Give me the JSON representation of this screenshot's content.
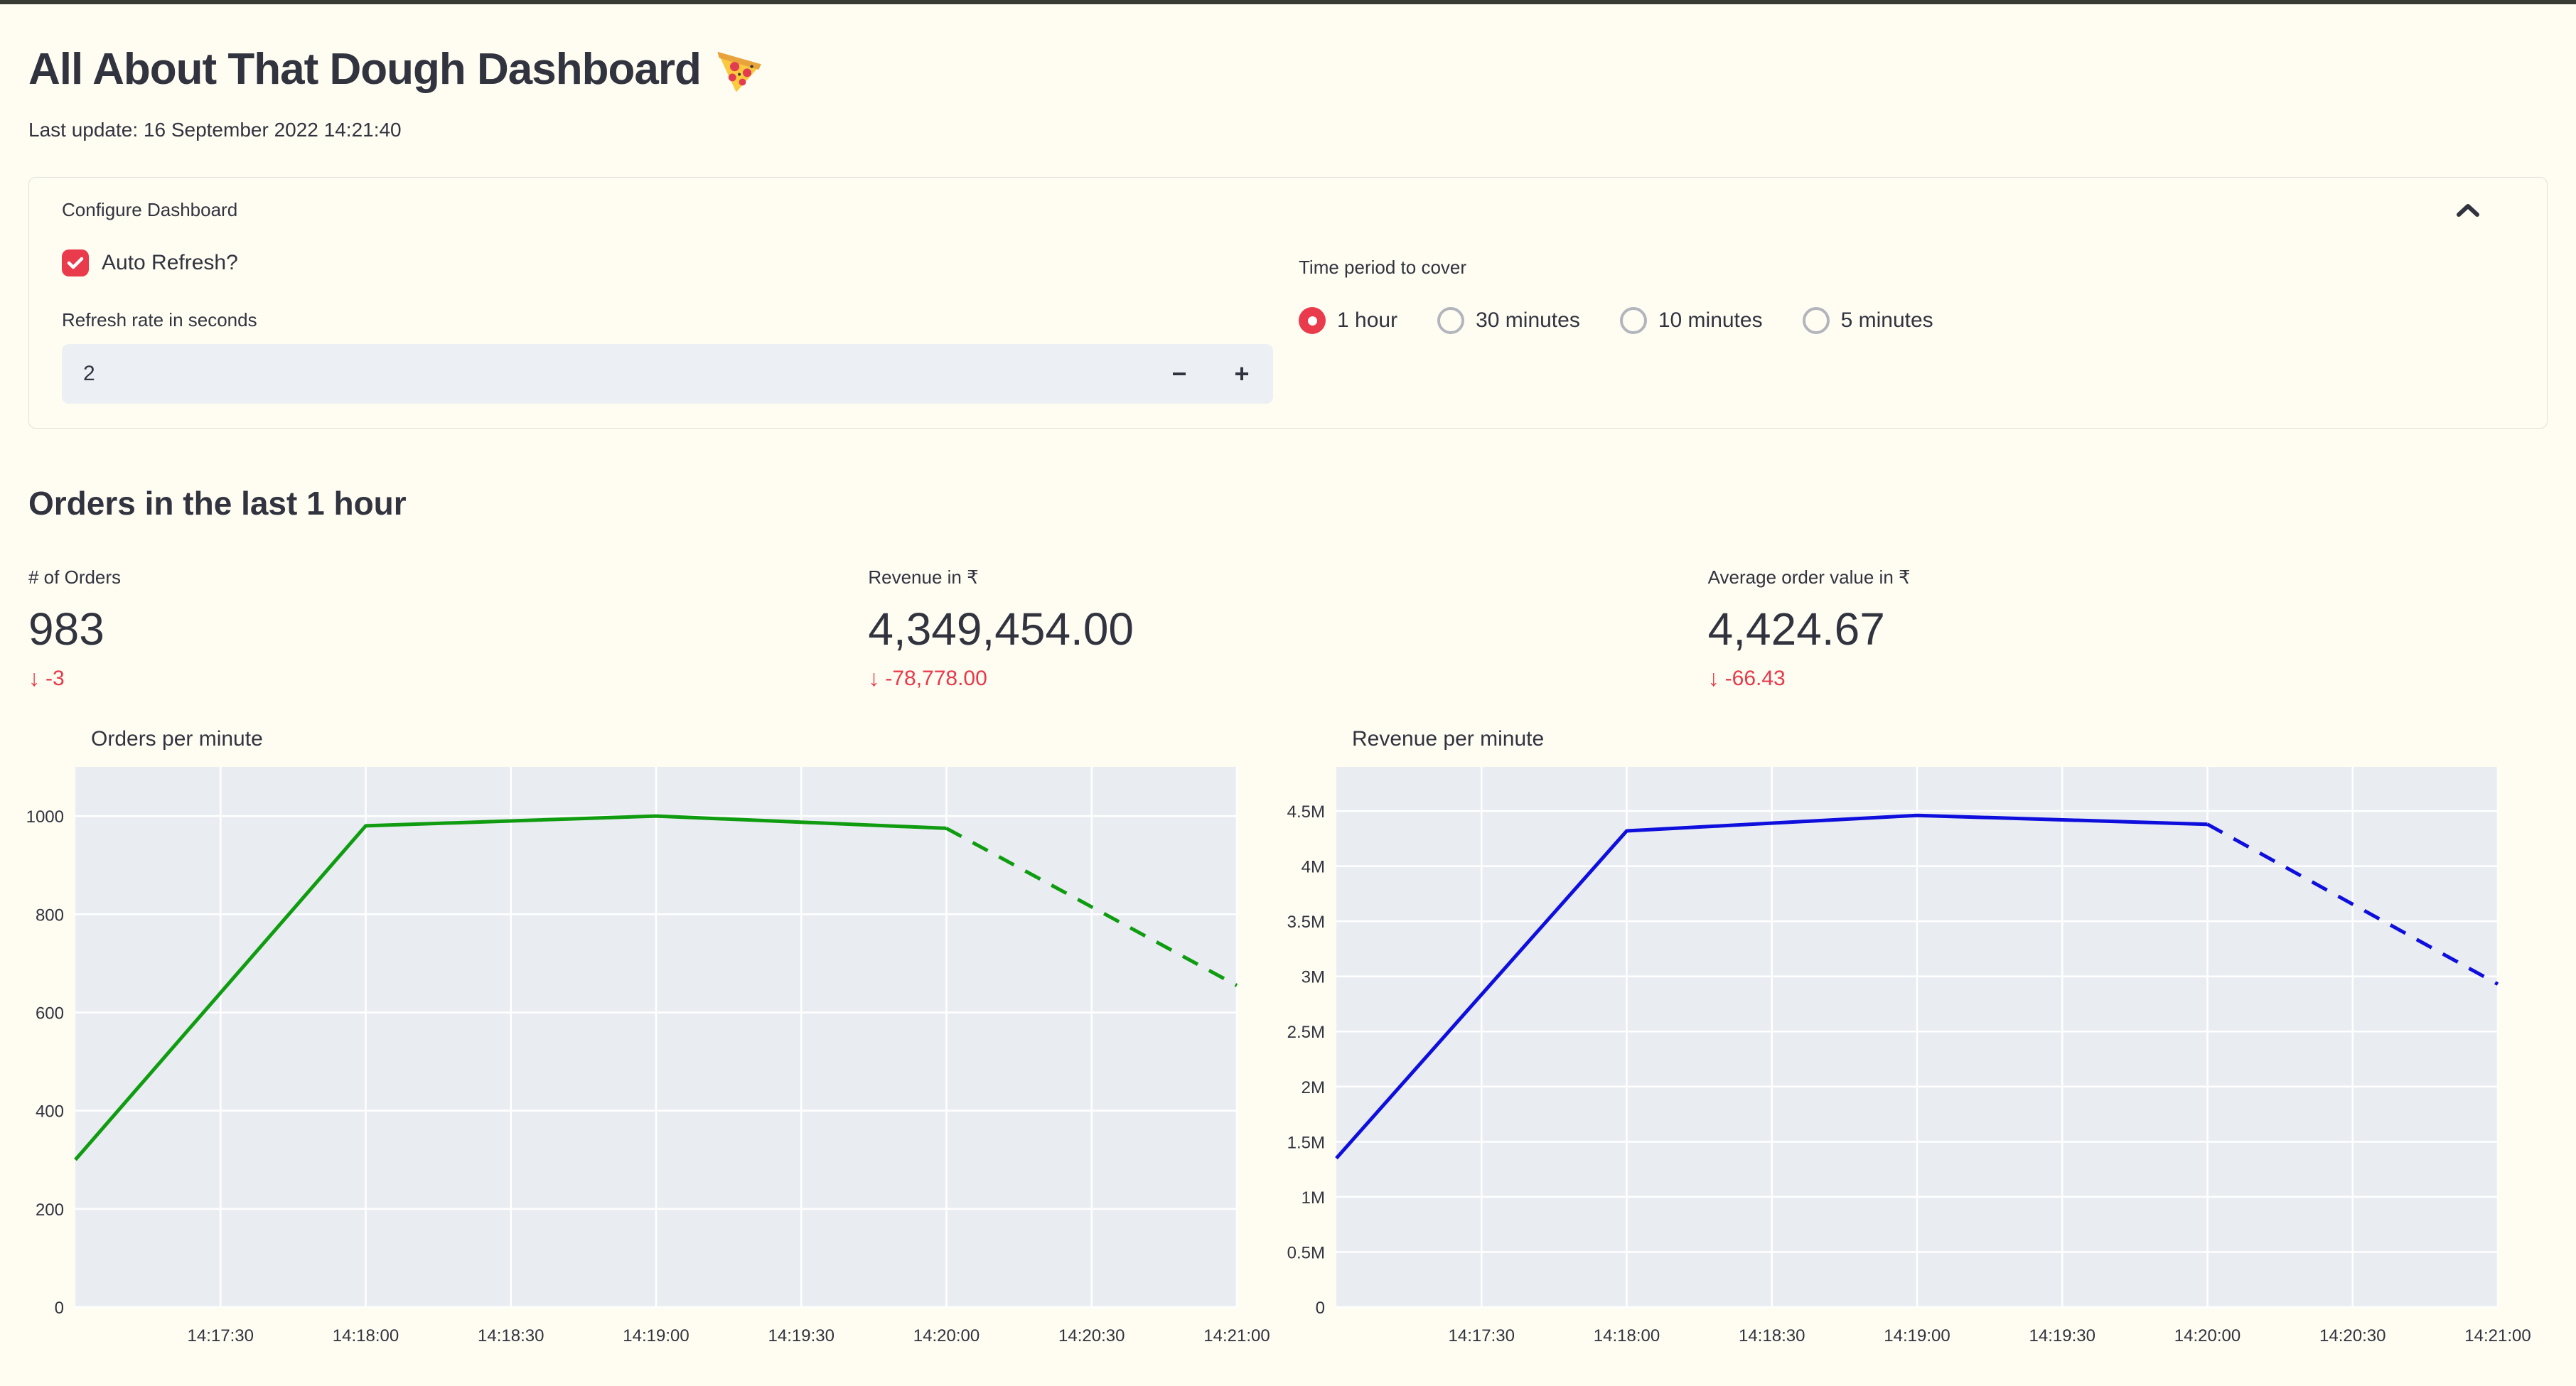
{
  "page": {
    "bg": "#fffdf2",
    "top_strip_color": "#3a3a34",
    "text_color": "#31333f",
    "accent_red": "#e93b4b",
    "delta_red": "#e8394a"
  },
  "header": {
    "title": "All About That Dough Dashboard",
    "title_icon": "pizza-slice",
    "last_update": "Last update: 16 September 2022 14:21:40"
  },
  "configure": {
    "title": "Configure Dashboard",
    "collapse_icon": "chevron-up",
    "auto_refresh_label": "Auto Refresh?",
    "auto_refresh_checked": true,
    "refresh_rate_label": "Refresh rate in seconds",
    "refresh_rate_value": "2",
    "minus_glyph": "−",
    "plus_glyph": "+",
    "time_period_label": "Time period to cover",
    "time_period_options": [
      {
        "label": "1 hour",
        "selected": true
      },
      {
        "label": "30 minutes",
        "selected": false
      },
      {
        "label": "10 minutes",
        "selected": false
      },
      {
        "label": "5 minutes",
        "selected": false
      }
    ]
  },
  "section": {
    "heading": "Orders in the last 1 hour"
  },
  "icons": {
    "arrow_down": "↓"
  },
  "metrics": [
    {
      "label": "# of Orders",
      "value": "983",
      "delta": "-3",
      "direction": "down"
    },
    {
      "label": "Revenue in ₹",
      "value": "4,349,454.00",
      "delta": "-78,778.00",
      "direction": "down"
    },
    {
      "label": "Average order value in ₹",
      "value": "4,424.67",
      "delta": "-66.43",
      "direction": "down"
    }
  ],
  "chart_data": [
    {
      "type": "line",
      "title": "Orders per minute",
      "line_color": "#109c10",
      "bg": "#e9edf2",
      "grid": true,
      "ylim": [
        0,
        1100
      ],
      "y_ticks": [
        {
          "v": 0,
          "label": "0"
        },
        {
          "v": 200,
          "label": "200"
        },
        {
          "v": 400,
          "label": "400"
        },
        {
          "v": 600,
          "label": "600"
        },
        {
          "v": 800,
          "label": "800"
        },
        {
          "v": 1000,
          "label": "1000"
        }
      ],
      "x_tick_labels": [
        "14:17:30",
        "14:18:00",
        "14:18:30",
        "14:19:00",
        "14:19:30",
        "14:20:00",
        "14:20:30",
        "14:21:00"
      ],
      "x_tick_fracs": [
        0.125,
        0.25,
        0.375,
        0.5,
        0.625,
        0.75,
        0.875,
        1.0
      ],
      "points": [
        {
          "x": 0.0,
          "time": "14:17:00",
          "y": 300
        },
        {
          "x": 0.25,
          "time": "14:18:00",
          "y": 980
        },
        {
          "x": 0.5,
          "time": "14:19:00",
          "y": 1000
        },
        {
          "x": 0.75,
          "time": "14:20:00",
          "y": 975
        },
        {
          "x": 1.0,
          "time": "14:21:00",
          "y": 655
        }
      ],
      "dashed_from_index": 3
    },
    {
      "type": "line",
      "title": "Revenue per minute",
      "line_color": "#0e0edd",
      "bg": "#e9edf2",
      "grid": true,
      "ylim": [
        0,
        4900000
      ],
      "y_ticks": [
        {
          "v": 0,
          "label": "0"
        },
        {
          "v": 500000,
          "label": "0.5M"
        },
        {
          "v": 1000000,
          "label": "1M"
        },
        {
          "v": 1500000,
          "label": "1.5M"
        },
        {
          "v": 2000000,
          "label": "2M"
        },
        {
          "v": 2500000,
          "label": "2.5M"
        },
        {
          "v": 3000000,
          "label": "3M"
        },
        {
          "v": 3500000,
          "label": "3.5M"
        },
        {
          "v": 4000000,
          "label": "4M"
        },
        {
          "v": 4500000,
          "label": "4.5M"
        }
      ],
      "x_tick_labels": [
        "14:17:30",
        "14:18:00",
        "14:18:30",
        "14:19:00",
        "14:19:30",
        "14:20:00",
        "14:20:30",
        "14:21:00"
      ],
      "x_tick_fracs": [
        0.125,
        0.25,
        0.375,
        0.5,
        0.625,
        0.75,
        0.875,
        1.0
      ],
      "points": [
        {
          "x": 0.0,
          "time": "14:17:00",
          "y": 1350000
        },
        {
          "x": 0.25,
          "time": "14:18:00",
          "y": 4320000
        },
        {
          "x": 0.5,
          "time": "14:19:00",
          "y": 4460000
        },
        {
          "x": 0.75,
          "time": "14:20:00",
          "y": 4380000
        },
        {
          "x": 1.0,
          "time": "14:21:00",
          "y": 2930000
        }
      ],
      "dashed_from_index": 3
    }
  ]
}
